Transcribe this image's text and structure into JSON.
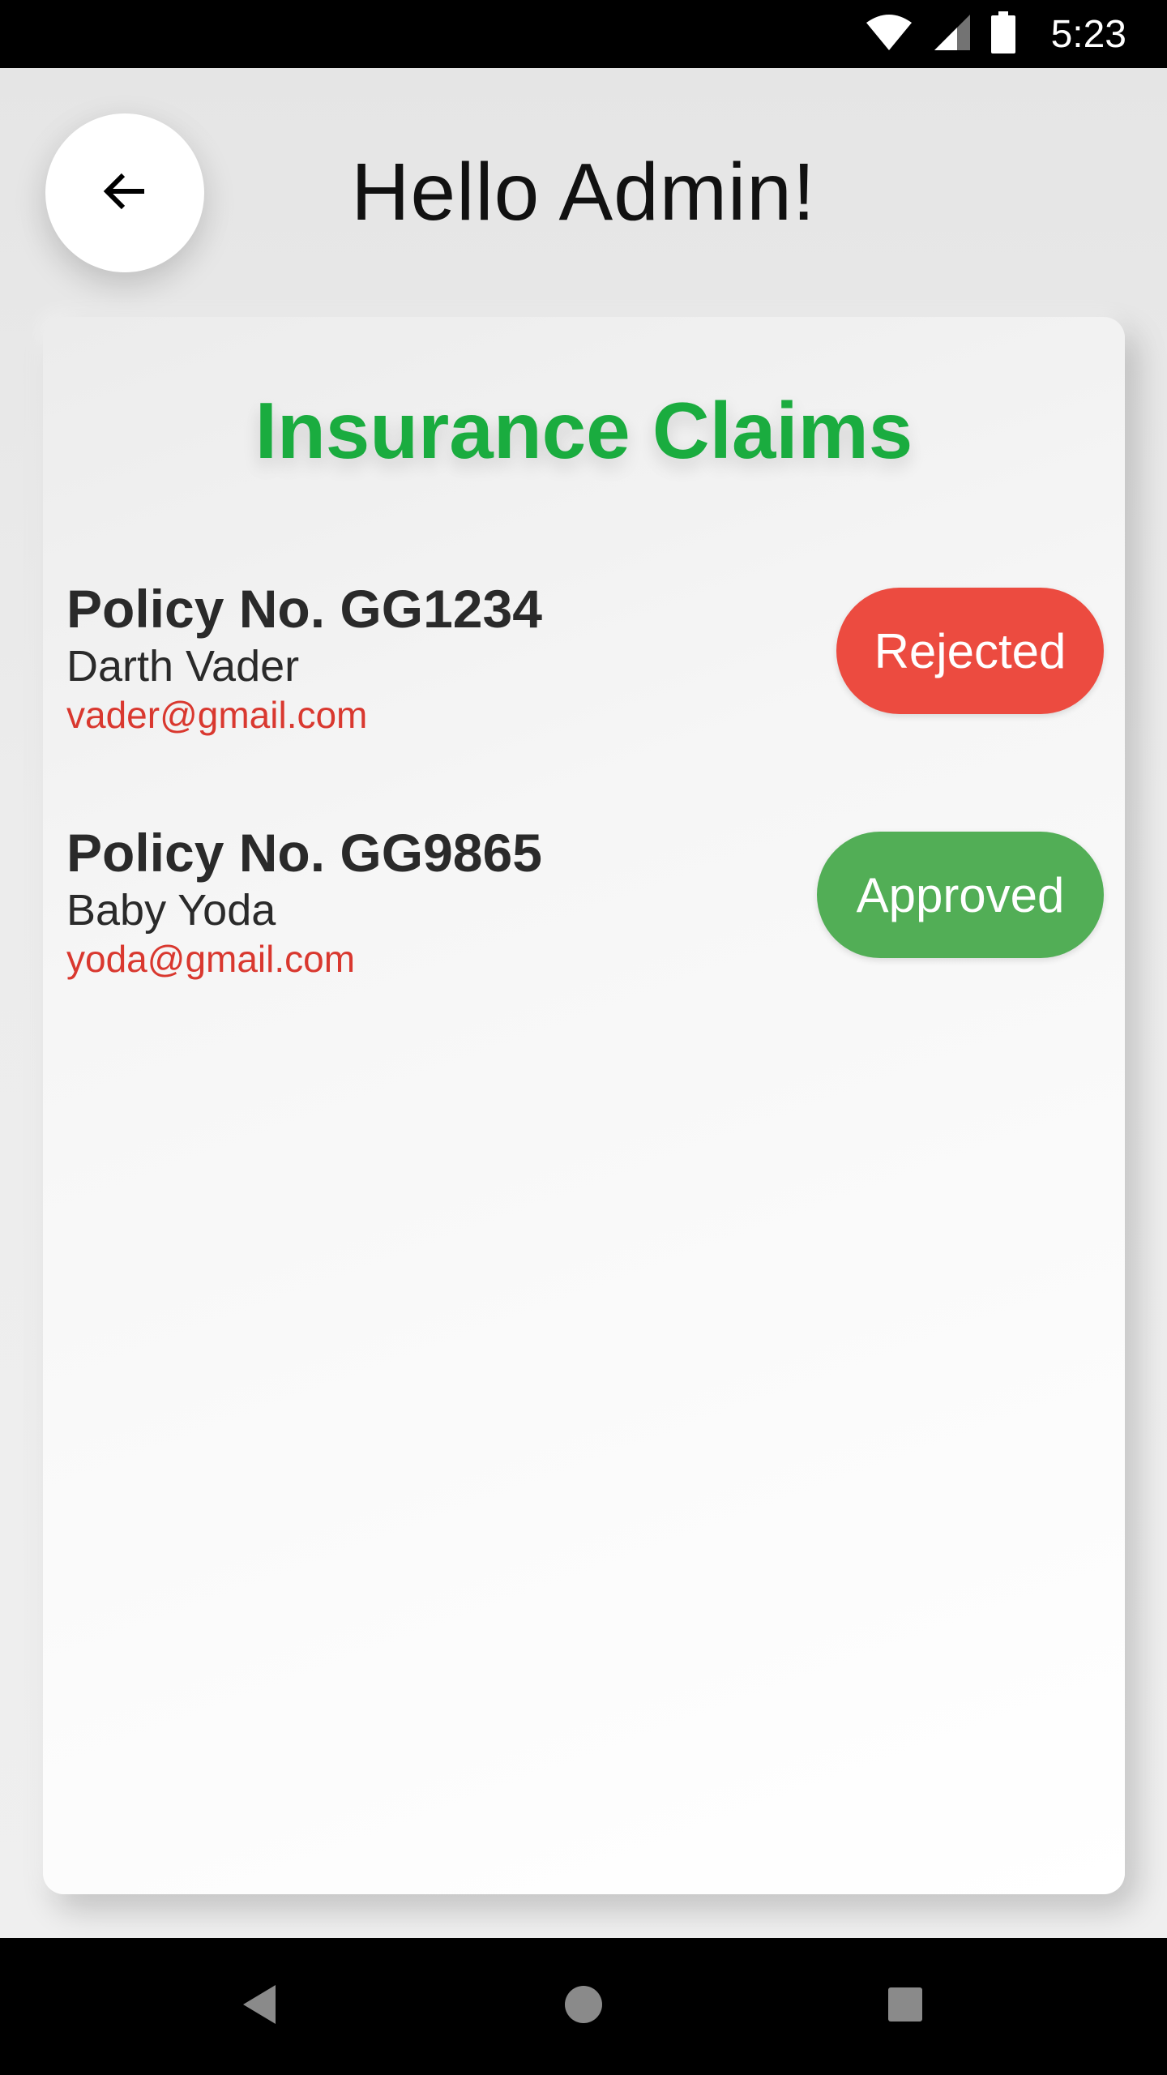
{
  "status_bar": {
    "time": "5:23",
    "icons": [
      "wifi-icon",
      "cell-signal-icon",
      "battery-icon"
    ]
  },
  "header": {
    "back_icon": "arrow-back-icon",
    "title": "Hello Admin!"
  },
  "card": {
    "title": "Insurance Claims",
    "claims": [
      {
        "policy": "Policy No. GG1234",
        "name": "Darth Vader",
        "email": "vader@gmail.com",
        "status": "Rejected",
        "status_color": "#ec4b40"
      },
      {
        "policy": "Policy No. GG9865",
        "name": "Baby Yoda",
        "email": "yoda@gmail.com",
        "status": "Approved",
        "status_color": "#52ae56"
      }
    ]
  },
  "colors": {
    "title_green": "#1aac3f",
    "email_red": "#d9382f",
    "text_dark": "#2a2a2a"
  },
  "nav_bar": {
    "buttons": [
      "nav-back-icon",
      "nav-home-icon",
      "nav-recents-icon"
    ]
  }
}
